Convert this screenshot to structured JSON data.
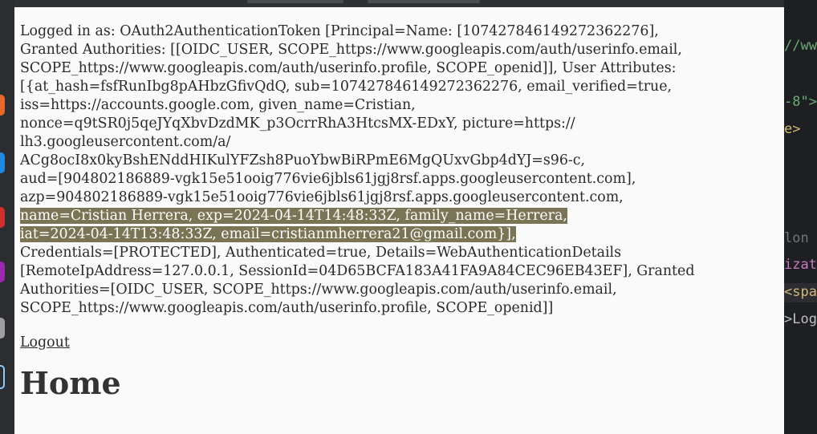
{
  "page": {
    "info_lines": [
      "Logged in as: OAuth2AuthenticationToken [Principal=Name: [107427846149272362276],",
      "Granted Authorities: [[OIDC_USER, SCOPE_https://www.googleapis.com/auth/userinfo.email,",
      "SCOPE_https://www.googleapis.com/auth/userinfo.profile, SCOPE_openid]], User Attributes:",
      "[{at_hash=fsfRunIbg8pAHbzGfivQdQ, sub=107427846149272362276, email_verified=true,",
      "iss=https://accounts.google.com, given_name=Cristian,",
      "nonce=q9tSR0j5qeJYqXbvDzdMK_p3OcrrRhA3HtcsMX-EDxY, picture=https://",
      "lh3.googleusercontent.com/a/",
      "ACg8ocI8x0kyBshENddHIKulYFZsh8PuoYbwBiRPmE6MgQUxvGbp4dYJ=s96-c,",
      "aud=[904802186889-vgk15e51ooig776vie6jbls61jgj8rsf.apps.googleusercontent.com],",
      "azp=904802186889-vgk15e51ooig776vie6jbls61jgj8rsf.apps.googleusercontent.com,",
      "name=Cristian Herrera, exp=2024-04-14T14:48:33Z, family_name=Herrera,",
      "iat=2024-04-14T13:48:33Z, email=cristianmherrera21@gmail.com}],",
      "Credentials=[PROTECTED], Authenticated=true, Details=WebAuthenticationDetails",
      "[RemoteIpAddress=127.0.0.1, SessionId=04D65BCFA183A41FA9A84CEC96EB43EF], Granted",
      "Authorities=[OIDC_USER, SCOPE_https://www.googleapis.com/auth/userinfo.email,",
      "SCOPE_https://www.googleapis.com/auth/userinfo.profile, SCOPE_openid]]"
    ],
    "logout_label": "Logout",
    "heading": "Home"
  },
  "editor_fragments": [
    "//www",
    "-8\">",
    "e>",
    "lon c",
    "izati",
    "<span",
    ">Logo"
  ],
  "colors": {
    "page_bg": "#fafafa",
    "text": "#2a2a2a",
    "selection_bg": "#787454",
    "selection_text": "#ffffff",
    "editor_bg": "#1e1f22",
    "editor_string": "#6aab73",
    "editor_tag": "#d5b778",
    "editor_plain": "#bcbec4",
    "editor_muted": "#6f737a",
    "editor_attr": "#c77dbb"
  }
}
